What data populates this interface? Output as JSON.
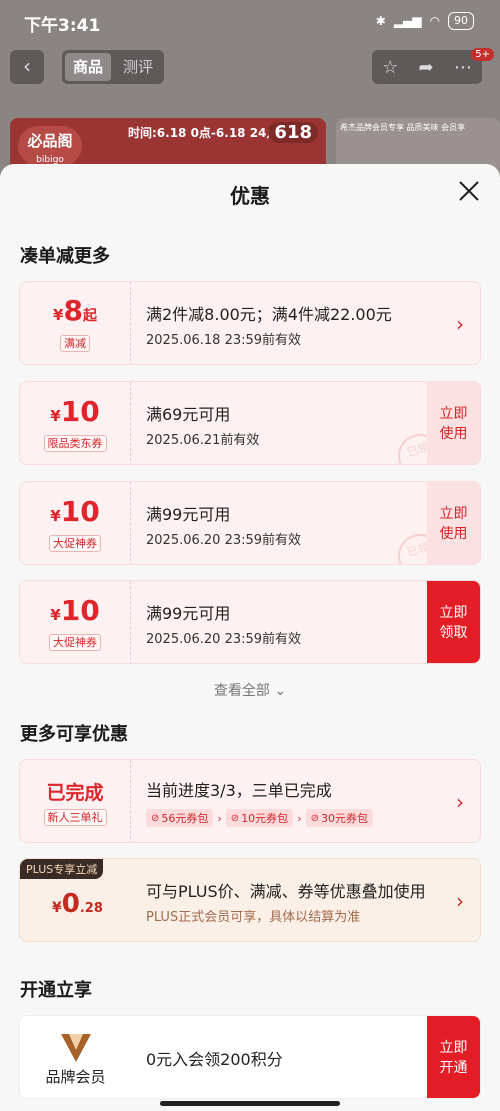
{
  "status_bar": {
    "time": "下午3:41",
    "battery": "90"
  },
  "background_page": {
    "tabs": [
      "商品",
      "测评"
    ],
    "badge": "5+",
    "banner_brand": "必品阁",
    "banner_brand_sub": "bibigo",
    "banner_time": "时间:6.18 0点-6.18 24点",
    "banner_number": "618",
    "banner_right_text": "希杰品牌会员专享 品质美味 会员享"
  },
  "sheet": {
    "title": "优惠",
    "section1_title": "凑单减更多",
    "coupons": [
      {
        "currency": "¥",
        "amount": "8",
        "suffix": "起",
        "tag": "满减",
        "main": "满2件减8.00元；满4件减22.00元",
        "sub": "2025.06.18 23:59前有效",
        "chevron": "›"
      },
      {
        "currency": "¥",
        "amount": "10",
        "tag": "限品类东券",
        "main": "满69元可用",
        "sub": "2025.06.21前有效",
        "action": "立即使用",
        "stamp": "已领"
      },
      {
        "currency": "¥",
        "amount": "10",
        "tag": "大促神券",
        "main": "满99元可用",
        "sub": "2025.06.20 23:59前有效",
        "action": "立即使用",
        "stamp": "已领"
      },
      {
        "currency": "¥",
        "amount": "10",
        "tag": "大促神券",
        "main": "满99元可用",
        "sub": "2025.06.20 23:59前有效",
        "action": "立即领取"
      }
    ],
    "see_all": "查看全部",
    "section2_title": "更多可享优惠",
    "newcomer": {
      "status": "已完成",
      "tag": "新人三单礼",
      "main": "当前进度3/3，三单已完成",
      "chips": [
        "56元券包",
        "10元券包",
        "30元券包"
      ]
    },
    "plus": {
      "label": "PLUS专享立减",
      "currency": "¥",
      "amount": "0",
      "decimal": ".28",
      "main": "可与PLUS价、满减、券等优惠叠加使用",
      "sub": "PLUS正式会员可享，具体以结算为准"
    },
    "section3_title": "开通立享",
    "member": {
      "name": "品牌会员",
      "main": "0元入会领200积分",
      "action": "立即开通"
    }
  },
  "colors": {
    "accent_red": "#e31d26",
    "text_red": "#d2262b",
    "card_bg": "#fdf1f1",
    "plus_bg": "#fbf0e8"
  }
}
